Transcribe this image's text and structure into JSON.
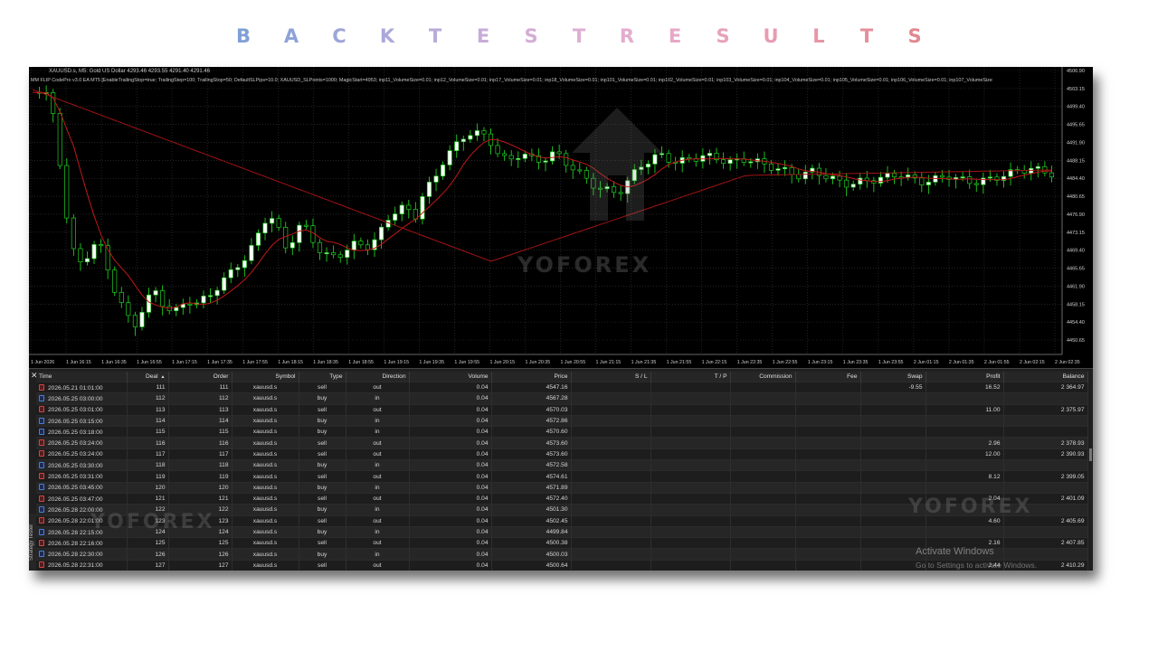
{
  "banner": {
    "letters": [
      "B",
      "A",
      "C",
      "K",
      "T",
      "E",
      "S",
      "T",
      "R",
      "E",
      "S",
      "U",
      "L",
      "T",
      "S"
    ],
    "colors": [
      "#7f9fd6",
      "#8ea3d8",
      "#9ea6d9",
      "#aba8da",
      "#b9aad9",
      "#c7acd8",
      "#d4aed6",
      "#deafd3",
      "#e3accd",
      "#e6a8c5",
      "#e7a2bb",
      "#e79cb1",
      "#e696a6",
      "#e48f9b",
      "#e28890"
    ]
  },
  "chart": {
    "symbol_line": "XAUUSD.s, M5:  Gold US Dollar  4293.46 4293.55 4291.40 4291.46",
    "params_line": "MM FLIP CodePro v3.0 EA MT5 [EnableTrailingStop=true; TrailingStep=100; TrailingStop=50; DefaultSLPips=10.0; XAUUSD_SLPoints=1000; MagicStart=4953; inp11_VolumeSize=0.01; inp12_VolumeSize=0.01; inp17_VolumeSize=0.01; inp18_VolumeSize=0.01; inp101_VolumeSize=0.01; inp102_VolumeSize=0.01; inp103_VolumeSize=0.01; inp104_VolumeSize=0.01; inp105_VolumeSize=0.01; inp106_VolumeSize=0.01; inp107_VolumeSize",
    "watermark": "YOFOREX",
    "y_ticks": [
      "4506.90",
      "4503.15",
      "4499.40",
      "4495.65",
      "4491.90",
      "4488.15",
      "4484.40",
      "4480.65",
      "4476.90",
      "4473.15",
      "4469.40",
      "4465.65",
      "4461.90",
      "4458.15",
      "4454.40",
      "4450.65"
    ],
    "x_ticks": [
      "1 Jun 2026",
      "1 Jun 16:15",
      "1 Jun 16:35",
      "1 Jun 16:55",
      "1 Jun 17:15",
      "1 Jun 17:35",
      "1 Jun 17:55",
      "1 Jun 18:15",
      "1 Jun 18:35",
      "1 Jun 18:55",
      "1 Jun 19:15",
      "1 Jun 19:35",
      "1 Jun 19:55",
      "1 Jun 20:15",
      "1 Jun 20:35",
      "1 Jun 20:55",
      "1 Jun 21:15",
      "1 Jun 21:35",
      "1 Jun 21:55",
      "1 Jun 22:15",
      "1 Jun 22:35",
      "1 Jun 22:55",
      "1 Jun 23:15",
      "1 Jun 23:35",
      "1 Jun 23:55",
      "2 Jun 01:15",
      "2 Jun 01:35",
      "2 Jun 01:55",
      "2 Jun 02:15",
      "2 Jun 02:35"
    ],
    "colors": {
      "bull": "#ffffff",
      "bear": "#000000",
      "wick": "#1fcf1f",
      "ma_fast": "#c01818",
      "ma_slow": "#a01414",
      "grid": "#3a3a3a"
    }
  },
  "table": {
    "columns": [
      "Time",
      "Deal",
      "Order",
      "Symbol",
      "Type",
      "Direction",
      "Volume",
      "Price",
      "S / L",
      "T / P",
      "Commission",
      "Fee",
      "Swap",
      "Profit",
      "Balance"
    ],
    "sort_indicator": "▲",
    "rows": [
      {
        "time": "2026.05.21 01:01:00",
        "deal": "111",
        "order": "111",
        "symbol": "xauusd.s",
        "type": "sell",
        "direction": "out",
        "volume": "0.04",
        "price": "4547.16",
        "sl": "",
        "tp": "",
        "commission": "",
        "fee": "",
        "swap": "-9.55",
        "profit": "16.52",
        "balance": "2 364.97"
      },
      {
        "time": "2026.05.25 03:00:00",
        "deal": "112",
        "order": "112",
        "symbol": "xauusd.s",
        "type": "buy",
        "direction": "in",
        "volume": "0.04",
        "price": "4567.28",
        "sl": "",
        "tp": "",
        "commission": "",
        "fee": "",
        "swap": "",
        "profit": "",
        "balance": ""
      },
      {
        "time": "2026.05.25 03:01:00",
        "deal": "113",
        "order": "113",
        "symbol": "xauusd.s",
        "type": "sell",
        "direction": "out",
        "volume": "0.04",
        "price": "4570.03",
        "sl": "",
        "tp": "",
        "commission": "",
        "fee": "",
        "swap": "",
        "profit": "11.00",
        "balance": "2 375.97"
      },
      {
        "time": "2026.05.25 03:15:00",
        "deal": "114",
        "order": "114",
        "symbol": "xauusd.s",
        "type": "buy",
        "direction": "in",
        "volume": "0.04",
        "price": "4572.86",
        "sl": "",
        "tp": "",
        "commission": "",
        "fee": "",
        "swap": "",
        "profit": "",
        "balance": ""
      },
      {
        "time": "2026.05.25 03:18:00",
        "deal": "115",
        "order": "115",
        "symbol": "xauusd.s",
        "type": "buy",
        "direction": "in",
        "volume": "0.04",
        "price": "4570.60",
        "sl": "",
        "tp": "",
        "commission": "",
        "fee": "",
        "swap": "",
        "profit": "",
        "balance": ""
      },
      {
        "time": "2026.05.25 03:24:00",
        "deal": "116",
        "order": "116",
        "symbol": "xauusd.s",
        "type": "sell",
        "direction": "out",
        "volume": "0.04",
        "price": "4573.60",
        "sl": "",
        "tp": "",
        "commission": "",
        "fee": "",
        "swap": "",
        "profit": "2.96",
        "balance": "2 378.93"
      },
      {
        "time": "2026.05.25 03:24:00",
        "deal": "117",
        "order": "117",
        "symbol": "xauusd.s",
        "type": "sell",
        "direction": "out",
        "volume": "0.04",
        "price": "4573.60",
        "sl": "",
        "tp": "",
        "commission": "",
        "fee": "",
        "swap": "",
        "profit": "12.00",
        "balance": "2 390.93"
      },
      {
        "time": "2026.05.25 03:30:00",
        "deal": "118",
        "order": "118",
        "symbol": "xauusd.s",
        "type": "buy",
        "direction": "in",
        "volume": "0.04",
        "price": "4572.58",
        "sl": "",
        "tp": "",
        "commission": "",
        "fee": "",
        "swap": "",
        "profit": "",
        "balance": ""
      },
      {
        "time": "2026.05.25 03:31:00",
        "deal": "119",
        "order": "119",
        "symbol": "xauusd.s",
        "type": "sell",
        "direction": "out",
        "volume": "0.04",
        "price": "4574.61",
        "sl": "",
        "tp": "",
        "commission": "",
        "fee": "",
        "swap": "",
        "profit": "8.12",
        "balance": "2 399.05"
      },
      {
        "time": "2026.05.25 03:45:00",
        "deal": "120",
        "order": "120",
        "symbol": "xauusd.s",
        "type": "buy",
        "direction": "in",
        "volume": "0.04",
        "price": "4571.89",
        "sl": "",
        "tp": "",
        "commission": "",
        "fee": "",
        "swap": "",
        "profit": "",
        "balance": ""
      },
      {
        "time": "2026.05.25 03:47:00",
        "deal": "121",
        "order": "121",
        "symbol": "xauusd.s",
        "type": "sell",
        "direction": "out",
        "volume": "0.04",
        "price": "4572.40",
        "sl": "",
        "tp": "",
        "commission": "",
        "fee": "",
        "swap": "",
        "profit": "2.04",
        "balance": "2 401.09"
      },
      {
        "time": "2026.05.28 22:00:00",
        "deal": "122",
        "order": "122",
        "symbol": "xauusd.s",
        "type": "buy",
        "direction": "in",
        "volume": "0.04",
        "price": "4501.30",
        "sl": "",
        "tp": "",
        "commission": "",
        "fee": "",
        "swap": "",
        "profit": "",
        "balance": ""
      },
      {
        "time": "2026.05.28 22:01:00",
        "deal": "123",
        "order": "123",
        "symbol": "xauusd.s",
        "type": "sell",
        "direction": "out",
        "volume": "0.04",
        "price": "4502.45",
        "sl": "",
        "tp": "",
        "commission": "",
        "fee": "",
        "swap": "",
        "profit": "4.60",
        "balance": "2 405.69"
      },
      {
        "time": "2026.05.28 22:15:00",
        "deal": "124",
        "order": "124",
        "symbol": "xauusd.s",
        "type": "buy",
        "direction": "in",
        "volume": "0.04",
        "price": "4499.84",
        "sl": "",
        "tp": "",
        "commission": "",
        "fee": "",
        "swap": "",
        "profit": "",
        "balance": ""
      },
      {
        "time": "2026.05.28 22:16:00",
        "deal": "125",
        "order": "125",
        "symbol": "xauusd.s",
        "type": "sell",
        "direction": "out",
        "volume": "0.04",
        "price": "4500.38",
        "sl": "",
        "tp": "",
        "commission": "",
        "fee": "",
        "swap": "",
        "profit": "2.16",
        "balance": "2 407.85"
      },
      {
        "time": "2026.05.28 22:30:00",
        "deal": "126",
        "order": "126",
        "symbol": "xauusd.s",
        "type": "buy",
        "direction": "in",
        "volume": "0.04",
        "price": "4500.03",
        "sl": "",
        "tp": "",
        "commission": "",
        "fee": "",
        "swap": "",
        "profit": "",
        "balance": ""
      },
      {
        "time": "2026.05.28 22:31:00",
        "deal": "127",
        "order": "127",
        "symbol": "xauusd.s",
        "type": "sell",
        "direction": "out",
        "volume": "0.04",
        "price": "4500.64",
        "sl": "",
        "tp": "",
        "commission": "",
        "fee": "",
        "swap": "",
        "profit": "2.44",
        "balance": "2 410.29"
      }
    ]
  },
  "side_tab": "Strategy Tester",
  "activation": {
    "title": "Activate Windows",
    "subtitle": "Go to Settings to activate Windows."
  },
  "close_icon": "close-icon"
}
